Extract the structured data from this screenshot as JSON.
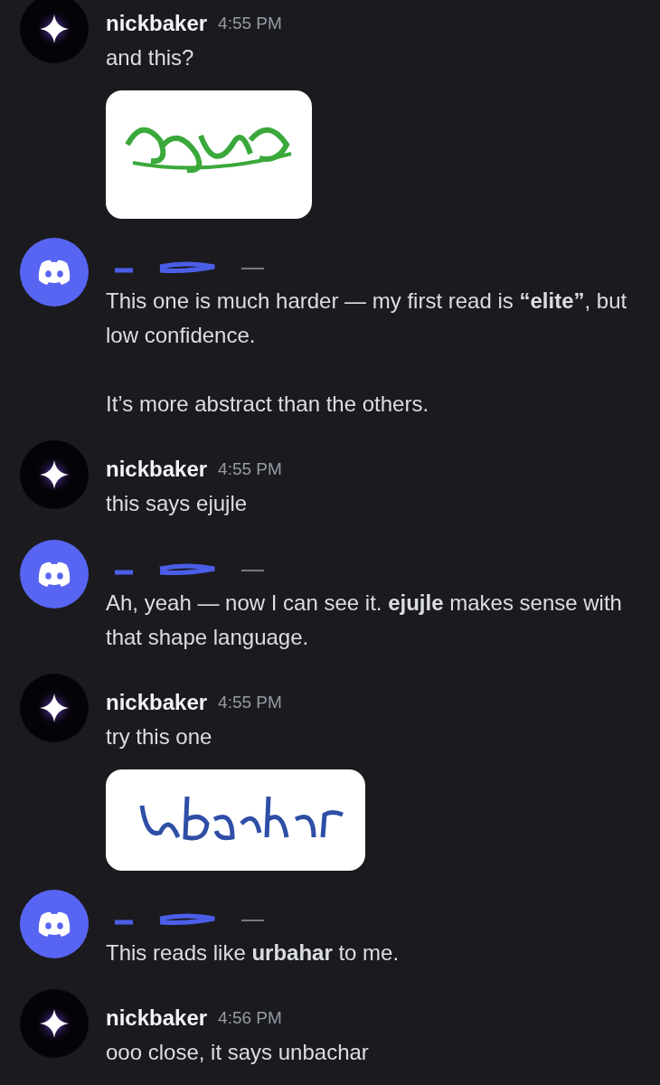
{
  "messages": [
    {
      "kind": "user",
      "author": "nickbaker",
      "time": "4:55 PM",
      "paragraphs": [
        "and this?"
      ],
      "attachment": {
        "kind": "picture"
      }
    },
    {
      "kind": "bot",
      "paragraphs": [
        "This one is much harder — my first read is **“elite”**, but low confidence.",
        "It’s more abstract than the others."
      ]
    },
    {
      "kind": "user",
      "author": "nickbaker",
      "time": "4:55 PM",
      "paragraphs": [
        "this says ejujle"
      ]
    },
    {
      "kind": "bot",
      "paragraphs": [
        "Ah, yeah — now I can see it. **ejujle** makes sense with that shape language."
      ]
    },
    {
      "kind": "user",
      "author": "nickbaker",
      "time": "4:55 PM",
      "paragraphs": [
        "try this one"
      ],
      "attachment": {
        "kind": "picture"
      }
    },
    {
      "kind": "bot",
      "paragraphs": [
        "This reads like **urbahar** to me."
      ]
    },
    {
      "kind": "user",
      "author": "nickbaker",
      "time": "4:56 PM",
      "paragraphs": [
        "ooo close, it says unbachar"
      ]
    }
  ]
}
